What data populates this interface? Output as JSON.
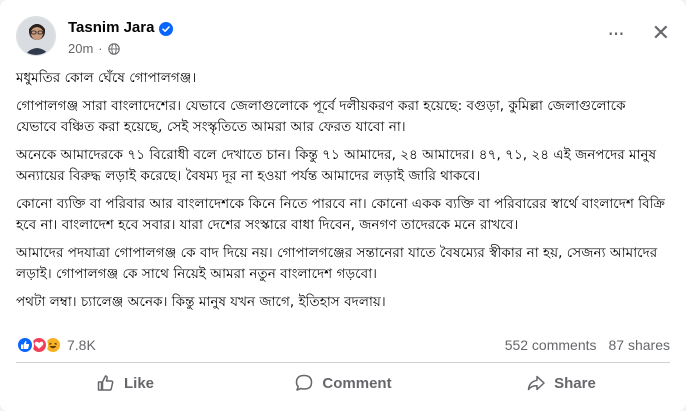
{
  "post": {
    "author": "Tasnim Jara",
    "time": "20m",
    "dot": "·",
    "privacy_icon": "globe-icon",
    "paragraphs": [
      "মধুমতির কোল ঘেঁষে গোপালগঞ্জ।",
      "গোপালগঞ্জ সারা বাংলাদেশের। যেভাবে জেলাগুলোকে পূর্বে দলীয়করণ করা হয়েছে: বগুড়া, কুমিল্লা জেলাগুলোকে যেভাবে বঞ্চিত করা হয়েছে, সেই সংস্কৃতিতে আমরা আর ফেরত যাবো না।",
      "অনেকে আমাদেরকে ৭১ বিরোধী বলে দেখাতে চান। কিন্তু ৭১ আমাদের, ২৪ আমাদের। ৪৭, ৭১, ২৪ এই জনপদের মানুষ অন্যায়ের বিরুদ্ধ লড়াই করেছে। বৈষম্য দূর না হওয়া পর্যন্ত আমাদের লড়াই জারি থাকবে।",
      "কোনো ব্যক্তি বা পরিবার আর বাংলাদেশকে কিনে নিতে পারবে না। কোনো একক ব্যক্তি বা পরিবারের স্বার্থে বাংলাদেশ বিক্রি হবে না। বাংলাদেশ হবে সবার। যারা দেশের সংস্কারে বাধা দিবেন, জনগণ তাদেরকে মনে রাখবে।",
      "আমাদের পদযাত্রা গোপালগঞ্জ কে বাদ দিয়ে নয়। গোপালগঞ্জের সন্তানেরা যাতে বৈষম্যের স্বীকার না হয়, সেজন্য আমাদের লড়াই। গোপালগঞ্জ কে সাথে নিয়েই আমরা নতুন বাংলাদেশ গড়বো।",
      "পথটা লম্বা। চ্যালেঞ্জ অনেক। কিন্তু মানুষ যখন জাগে, ইতিহাস বদলায়।"
    ]
  },
  "stats": {
    "reaction_count": "7.8K",
    "comments": "552 comments",
    "shares": "87 shares",
    "reaction_icons": [
      "like-icon",
      "love-icon",
      "haha-icon"
    ]
  },
  "actions": {
    "like_label": "Like",
    "comment_label": "Comment",
    "share_label": "Share"
  },
  "header": {
    "more_label": "···",
    "close_label": "✕"
  },
  "colors": {
    "verified": "#0866ff",
    "like": "#0866ff",
    "love": "#f33e58",
    "haha": "#f7b125",
    "secondary_text": "#65676b"
  }
}
